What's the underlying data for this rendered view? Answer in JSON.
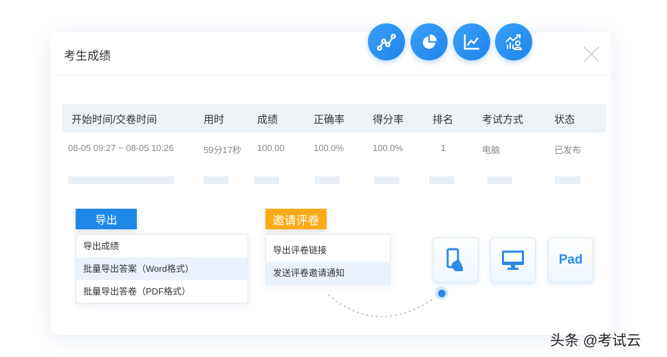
{
  "header": {
    "title": "考生成绩"
  },
  "toolbar_icons": [
    "line-chart-nodes-icon",
    "pie-chart-icon",
    "line-chart-icon",
    "growth-user-icon"
  ],
  "table": {
    "columns": [
      "开始时间/交卷时间",
      "用时",
      "成绩",
      "正确率",
      "得分率",
      "排名",
      "考试方式",
      "状态"
    ],
    "rows": [
      [
        "08-05 09:27 ~ 08-05 10:26",
        "59分17秒",
        "100.00",
        "100.0%",
        "100.0%",
        "1",
        "电脑",
        "已发布"
      ]
    ]
  },
  "export": {
    "label": "导出",
    "color": "#1e88e8",
    "items": [
      "导出成绩",
      "批量导出答案（Word格式）",
      "批量导出答卷（PDF格式）"
    ]
  },
  "invite": {
    "label": "邀请评卷",
    "color": "#fbaa18",
    "items": [
      "导出评卷链接",
      "发送评卷邀请通知"
    ]
  },
  "devices": {
    "pad_label": "Pad"
  },
  "watermark": "头条 @考试云"
}
